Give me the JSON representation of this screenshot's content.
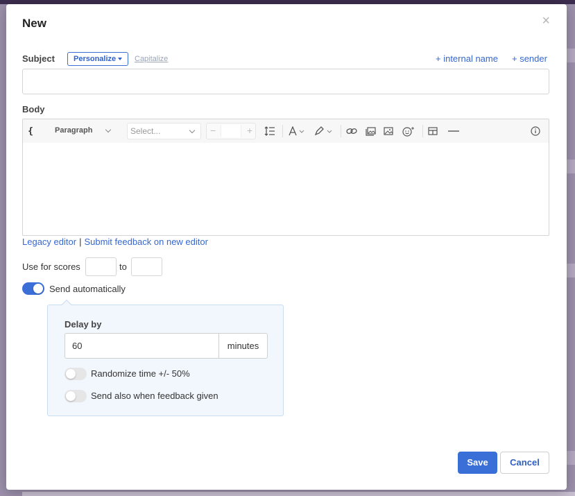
{
  "modal": {
    "title": "New",
    "close": "×"
  },
  "subject": {
    "label": "Subject",
    "personalize_label": "Personalize",
    "capitalize_label": "Capitalize",
    "internal_name_link": "+ internal name",
    "sender_link": "+ sender",
    "value": ""
  },
  "body": {
    "label": "Body",
    "toolbar": {
      "code_glyph": "{",
      "format_value": "Paragraph",
      "font_placeholder": "Select...",
      "size_minus": "−",
      "size_plus": "+",
      "icons": [
        "code-icon",
        "line-height-icon",
        "font-color-icon",
        "highlight-pen-icon",
        "link-icon",
        "image-gallery-icon",
        "image-icon",
        "emoji-icon",
        "table-icon",
        "horizontal-rule-icon",
        "info-icon"
      ]
    },
    "legacy_link": "Legacy editor",
    "separator": "|",
    "feedback_link": "Submit feedback on new editor"
  },
  "scores": {
    "label": "Use for scores",
    "to_label": "to",
    "from_value": "",
    "to_value": ""
  },
  "send_automatically": {
    "label": "Send automatically",
    "enabled": true
  },
  "delay": {
    "label": "Delay by",
    "value": "60",
    "unit": "minutes",
    "randomize_label": "Randomize time +/- 50%",
    "randomize_enabled": false,
    "feedback_label": "Send also when feedback given",
    "feedback_enabled": false
  },
  "actions": {
    "save": "Save",
    "cancel": "Cancel"
  },
  "colors": {
    "accent": "#3a6fd8",
    "link": "#3467d0",
    "backdrop": "#9c90ac"
  }
}
